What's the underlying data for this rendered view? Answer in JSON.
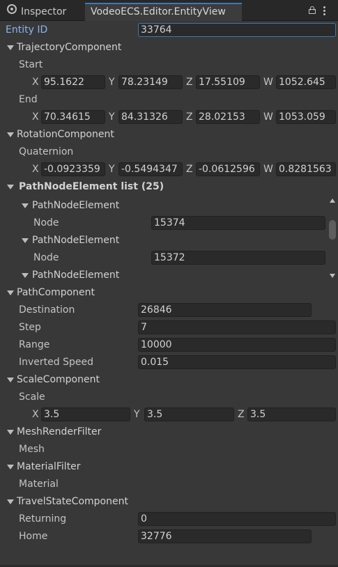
{
  "tabs": {
    "inspector": "Inspector",
    "entity_view": "VodeoECS.Editor.EntityView"
  },
  "entity": {
    "label": "Entity ID",
    "value": "33764"
  },
  "trajectory": {
    "title": "TrajectoryComponent",
    "start_label": "Start",
    "start": {
      "x": "95.1622",
      "y": "78.23149",
      "z": "17.55109",
      "w": "1052.645"
    },
    "end_label": "End",
    "end": {
      "x": "70.34615",
      "y": "84.31326",
      "z": "28.02153",
      "w": "1053.059"
    }
  },
  "rotation": {
    "title": "RotationComponent",
    "quat_label": "Quaternion",
    "quat": {
      "x": "-0.0923359",
      "y": "-0.5494347",
      "z": "-0.0612596",
      "w": "0.8281563"
    }
  },
  "pathnode": {
    "title": "PathNodeElement list (25)",
    "elements": [
      {
        "title": "PathNodeElement",
        "node_label": "Node",
        "node": "15374"
      },
      {
        "title": "PathNodeElement",
        "node_label": "Node",
        "node": "15372"
      },
      {
        "title": "PathNodeElement"
      }
    ]
  },
  "path": {
    "title": "PathComponent",
    "destination_label": "Destination",
    "destination": "26846",
    "step_label": "Step",
    "step": "7",
    "range_label": "Range",
    "range": "10000",
    "inverted_speed_label": "Inverted Speed",
    "inverted_speed": "0.015"
  },
  "scale": {
    "title": "ScaleComponent",
    "scale_label": "Scale",
    "value": {
      "x": "3.5",
      "y": "3.5",
      "z": "3.5"
    }
  },
  "mesh": {
    "title": "MeshRenderFilter",
    "label": "Mesh"
  },
  "material": {
    "title": "MaterialFilter",
    "label": "Material"
  },
  "travel": {
    "title": "TravelStateComponent",
    "returning_label": "Returning",
    "returning": "0",
    "home_label": "Home",
    "home": "32776"
  },
  "axes": {
    "x": "X",
    "y": "Y",
    "z": "Z",
    "w": "W"
  },
  "icons": {
    "inspector": "inspector-icon",
    "lock": "lock-icon",
    "menu": "kebab-menu-icon"
  },
  "colors": {
    "accent": "#3a79bb",
    "background": "#383838",
    "field": "#2a2a2a"
  }
}
